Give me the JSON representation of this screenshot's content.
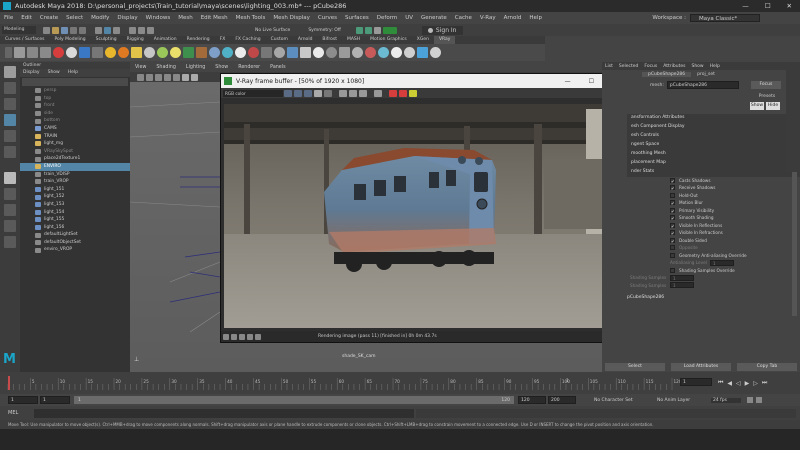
{
  "window": {
    "title": "Autodesk Maya 2018: D:\\personal_projects\\Train_tutorial\\maya\\scenes\\lighting_003.mb* --- pCube286",
    "menus": [
      "File",
      "Edit",
      "Create",
      "Select",
      "Modify",
      "Display",
      "Windows",
      "Mesh",
      "Edit Mesh",
      "Mesh Tools",
      "Mesh Display",
      "Curves",
      "Surfaces",
      "Deform",
      "UV",
      "Generate",
      "Cache",
      "V-Ray",
      "Arnold",
      "Help"
    ],
    "workspace_label": "Workspace :",
    "workspace_value": "Maya Classic*"
  },
  "statusline": {
    "mode": "Modeling",
    "live_surface": "No Live Surface",
    "symmetry": "Symmetry: Off",
    "sign_in": "Sign In"
  },
  "shelf": {
    "tabs": [
      "Curves / Surfaces",
      "Poly Modeling",
      "Sculpting",
      "Rigging",
      "Animation",
      "Rendering",
      "FX",
      "FX Caching",
      "Custom",
      "Arnold",
      "Bifrost",
      "MASH",
      "Motion Graphics",
      "XGen",
      "VRay"
    ]
  },
  "outliner": {
    "header": "Outliner",
    "menus": [
      "Display",
      "Show",
      "Help"
    ],
    "items": [
      {
        "label": "persp",
        "dim": true
      },
      {
        "label": "top",
        "dim": true
      },
      {
        "label": "front",
        "dim": true
      },
      {
        "label": "side",
        "dim": true
      },
      {
        "label": "bottom",
        "dim": true
      },
      {
        "label": "CAMS",
        "dim": false
      },
      {
        "label": "TRAIN",
        "dim": false
      },
      {
        "label": "light_mg",
        "dim": false
      },
      {
        "label": "VRaySkySpot",
        "dim": true
      },
      {
        "label": "place2dTexture1",
        "dim": false
      },
      {
        "label": "ENVIRO",
        "dim": false,
        "selected": true
      },
      {
        "label": "train_VDISP",
        "dim": false
      },
      {
        "label": "train_VROP",
        "dim": false
      },
      {
        "label": "light_151",
        "dim": false
      },
      {
        "label": "light_152",
        "dim": false
      },
      {
        "label": "light_153",
        "dim": false
      },
      {
        "label": "light_154",
        "dim": false
      },
      {
        "label": "light_155",
        "dim": false
      },
      {
        "label": "light_156",
        "dim": false
      },
      {
        "label": "defaultLightSet",
        "dim": false
      },
      {
        "label": "defaultObjectSet",
        "dim": false
      },
      {
        "label": "enviro_VROP",
        "dim": false
      }
    ]
  },
  "viewport": {
    "menus": [
      "View",
      "Shading",
      "Lighting",
      "Show",
      "Renderer",
      "Panels"
    ],
    "camera_label": "shade_SK_cam"
  },
  "vfb": {
    "title": "V-Ray frame buffer - [50% of 1920 x 1080]",
    "channel": "RGB color",
    "status": "Rendering image (pass 11) [finished in] 0h 0m 43.7s"
  },
  "attr": {
    "tabs": [
      "List",
      "Selected",
      "Focus",
      "Attributes",
      "Show",
      "Help"
    ],
    "node_tabs": [
      "pCubeShape286",
      "proj_set"
    ],
    "mesh_label": "mesh:",
    "mesh_value": "pCubeShape286",
    "focus_btn": "Focus",
    "presets_btn": "Presets",
    "show_btn": "Show",
    "hide_btn": "Hide",
    "sections": [
      "ansformation Attributes",
      "esh Component Display",
      "esh Controls",
      "ngent Space",
      "moothing Mesh",
      "placement Map",
      "nder Stats"
    ],
    "render_stats": [
      {
        "label": "Casts Shadows",
        "checked": true,
        "dim": false
      },
      {
        "label": "Receive Shadows",
        "checked": true,
        "dim": false
      },
      {
        "label": "Hold-Out",
        "checked": false,
        "dim": false
      },
      {
        "label": "Motion Blur",
        "checked": true,
        "dim": false
      },
      {
        "label": "Primary Visibility",
        "checked": true,
        "dim": false
      },
      {
        "label": "Smooth Shading",
        "checked": true,
        "dim": false
      },
      {
        "label": "Visible In Reflections",
        "checked": true,
        "dim": false
      },
      {
        "label": "Visible In Refractions",
        "checked": true,
        "dim": false
      },
      {
        "label": "Double Sided",
        "checked": true,
        "dim": false
      },
      {
        "label": "Opposite",
        "checked": false,
        "dim": true
      },
      {
        "label": "Geometry Anti-aliasing Override",
        "checked": false,
        "dim": false
      }
    ],
    "aa_level_label": "Antialiasing Level",
    "aa_level_value": "1",
    "shading_override": "Shading Samples Override",
    "shading_samples_label": "Shading Samples",
    "shading_samples_value": "1",
    "max_shading_label": "Shading Samples",
    "max_shading_value": "1",
    "footer_node": "pCubeShape286",
    "bottom_buttons": [
      "Select",
      "Load Attributes",
      "Copy Tab"
    ]
  },
  "timeline": {
    "current_frame": "1",
    "ticks": [
      "5",
      "10",
      "15",
      "20",
      "25",
      "30",
      "35",
      "40",
      "45",
      "50",
      "55",
      "60",
      "65",
      "70",
      "75",
      "80",
      "85",
      "90",
      "95",
      "100",
      "105",
      "110",
      "115",
      "120"
    ],
    "field_frame": "1",
    "range_start": "1",
    "range_inner_start": "1",
    "range_inner_end": "120",
    "range_end": "120",
    "range_end2": "200",
    "character_set": "No Character Set",
    "anim_layer": "No Anim Layer",
    "fps": "24 fps"
  },
  "command": {
    "label": "MEL",
    "help": "Move Tool: Use manipulator to move object(s). Ctrl+MMB+drag to move components along normals. Shift+drag manipulator axis or plane handle to extrude components or clone objects. Ctrl+Shift+LMB+drag to constrain movement to a connected edge. Use D or INSERT to change the pivot position and axis orientation."
  },
  "colors": {
    "selection": "#5285a6",
    "vray_accent": "#2f8c3a",
    "maya_logo": "#1aa5c9"
  }
}
